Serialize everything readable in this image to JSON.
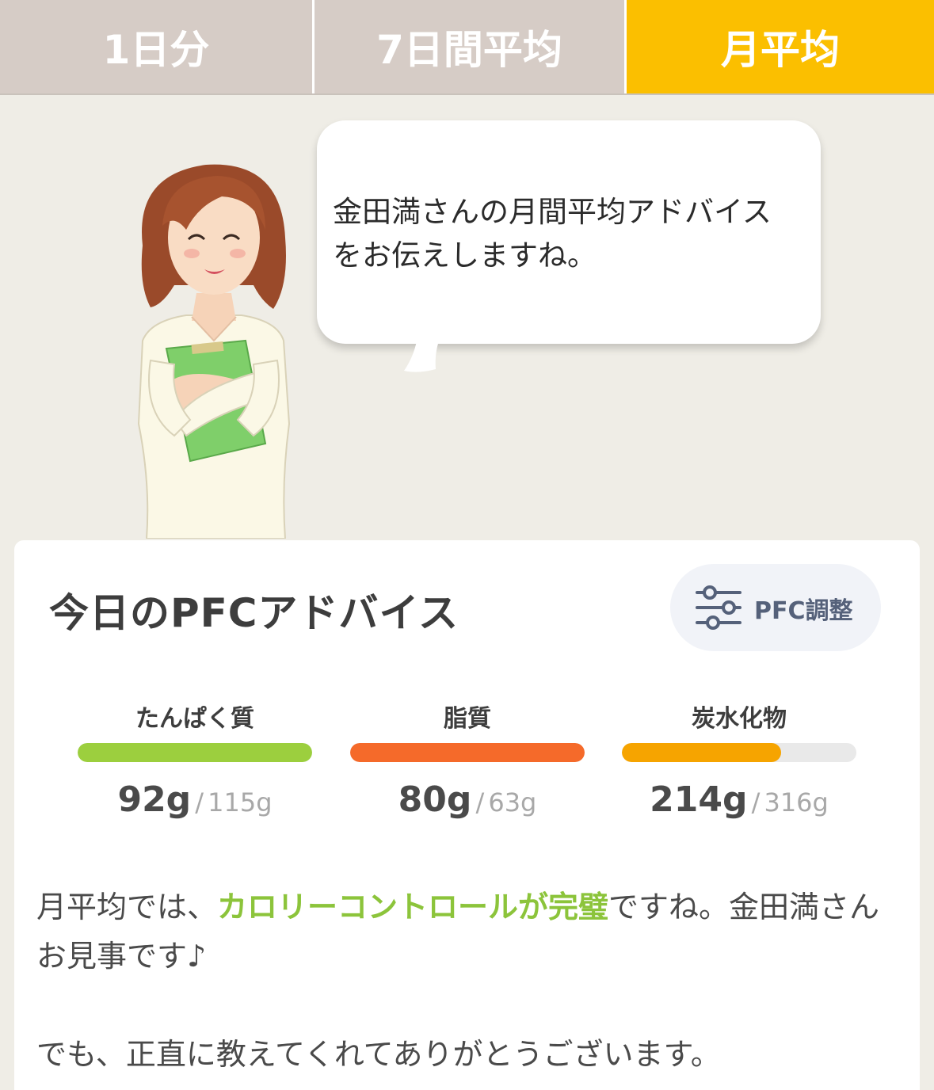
{
  "tabs": [
    {
      "label": "1日分",
      "active": false
    },
    {
      "label": "7日間平均",
      "active": false
    },
    {
      "label": "月平均",
      "active": true
    }
  ],
  "colors": {
    "tab_inactive": "#d6ccc6",
    "tab_active": "#fbbf00",
    "background": "#efede6",
    "highlight": "#8cc43b"
  },
  "bubble": {
    "line1": "金田満さんの月間平均アドバイス",
    "line2": "をお伝えしますね。"
  },
  "card": {
    "title": "今日のPFCアドバイス",
    "pfc_button": {
      "label": "PFC調整",
      "icon": "sliders-icon"
    },
    "nutrients": [
      {
        "name": "たんぱく質",
        "value": "92g",
        "sep": "/",
        "target": "115g",
        "progress": 1.0,
        "color": "#9ccf3e"
      },
      {
        "name": "脂質",
        "value": "80g",
        "sep": "/",
        "target": "63g",
        "progress": 1.0,
        "color": "#f56a2a"
      },
      {
        "name": "炭水化物",
        "value": "214g",
        "sep": "/",
        "target": "316g",
        "progress": 0.68,
        "color": "#f6a400"
      }
    ],
    "advice": {
      "p1_before": "月平均では、",
      "p1_highlight": "カロリーコントロールが完璧",
      "p1_after": "ですね。金田満さんお見事です♪",
      "p2": "でも、正直に教えてくれてありがとうございます。"
    }
  }
}
